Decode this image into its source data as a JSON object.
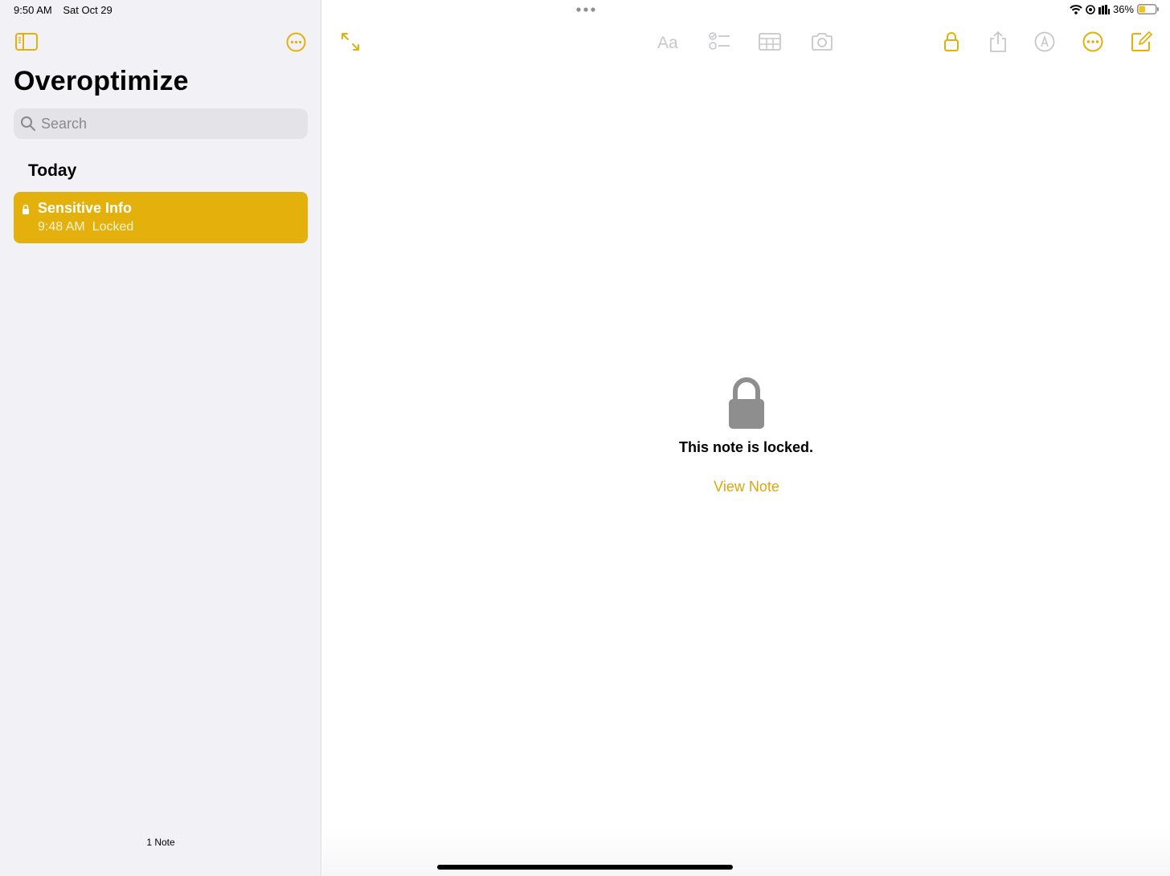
{
  "status": {
    "time": "9:50 AM",
    "date": "Sat Oct 29",
    "battery": "36%"
  },
  "sidebar": {
    "folder_title": "Overoptimize",
    "search_placeholder": "Search",
    "section": "Today",
    "notes": [
      {
        "title": "Sensitive Info",
        "time": "9:48 AM",
        "status": "Locked"
      }
    ],
    "count": "1 Note"
  },
  "main": {
    "locked_message": "This note is locked.",
    "view_note_label": "View Note"
  },
  "toolbar": {
    "icons": [
      "expand-icon",
      "text-format-icon",
      "checklist-icon",
      "table-icon",
      "camera-icon",
      "lock-icon",
      "share-icon",
      "markup-icon",
      "more-icon",
      "compose-icon"
    ]
  },
  "colors": {
    "accent": "#e4b00c",
    "disabled": "#c7c7cc",
    "sidebar_bg": "#f2f2f6",
    "lock_gray": "#8e8e8e"
  }
}
